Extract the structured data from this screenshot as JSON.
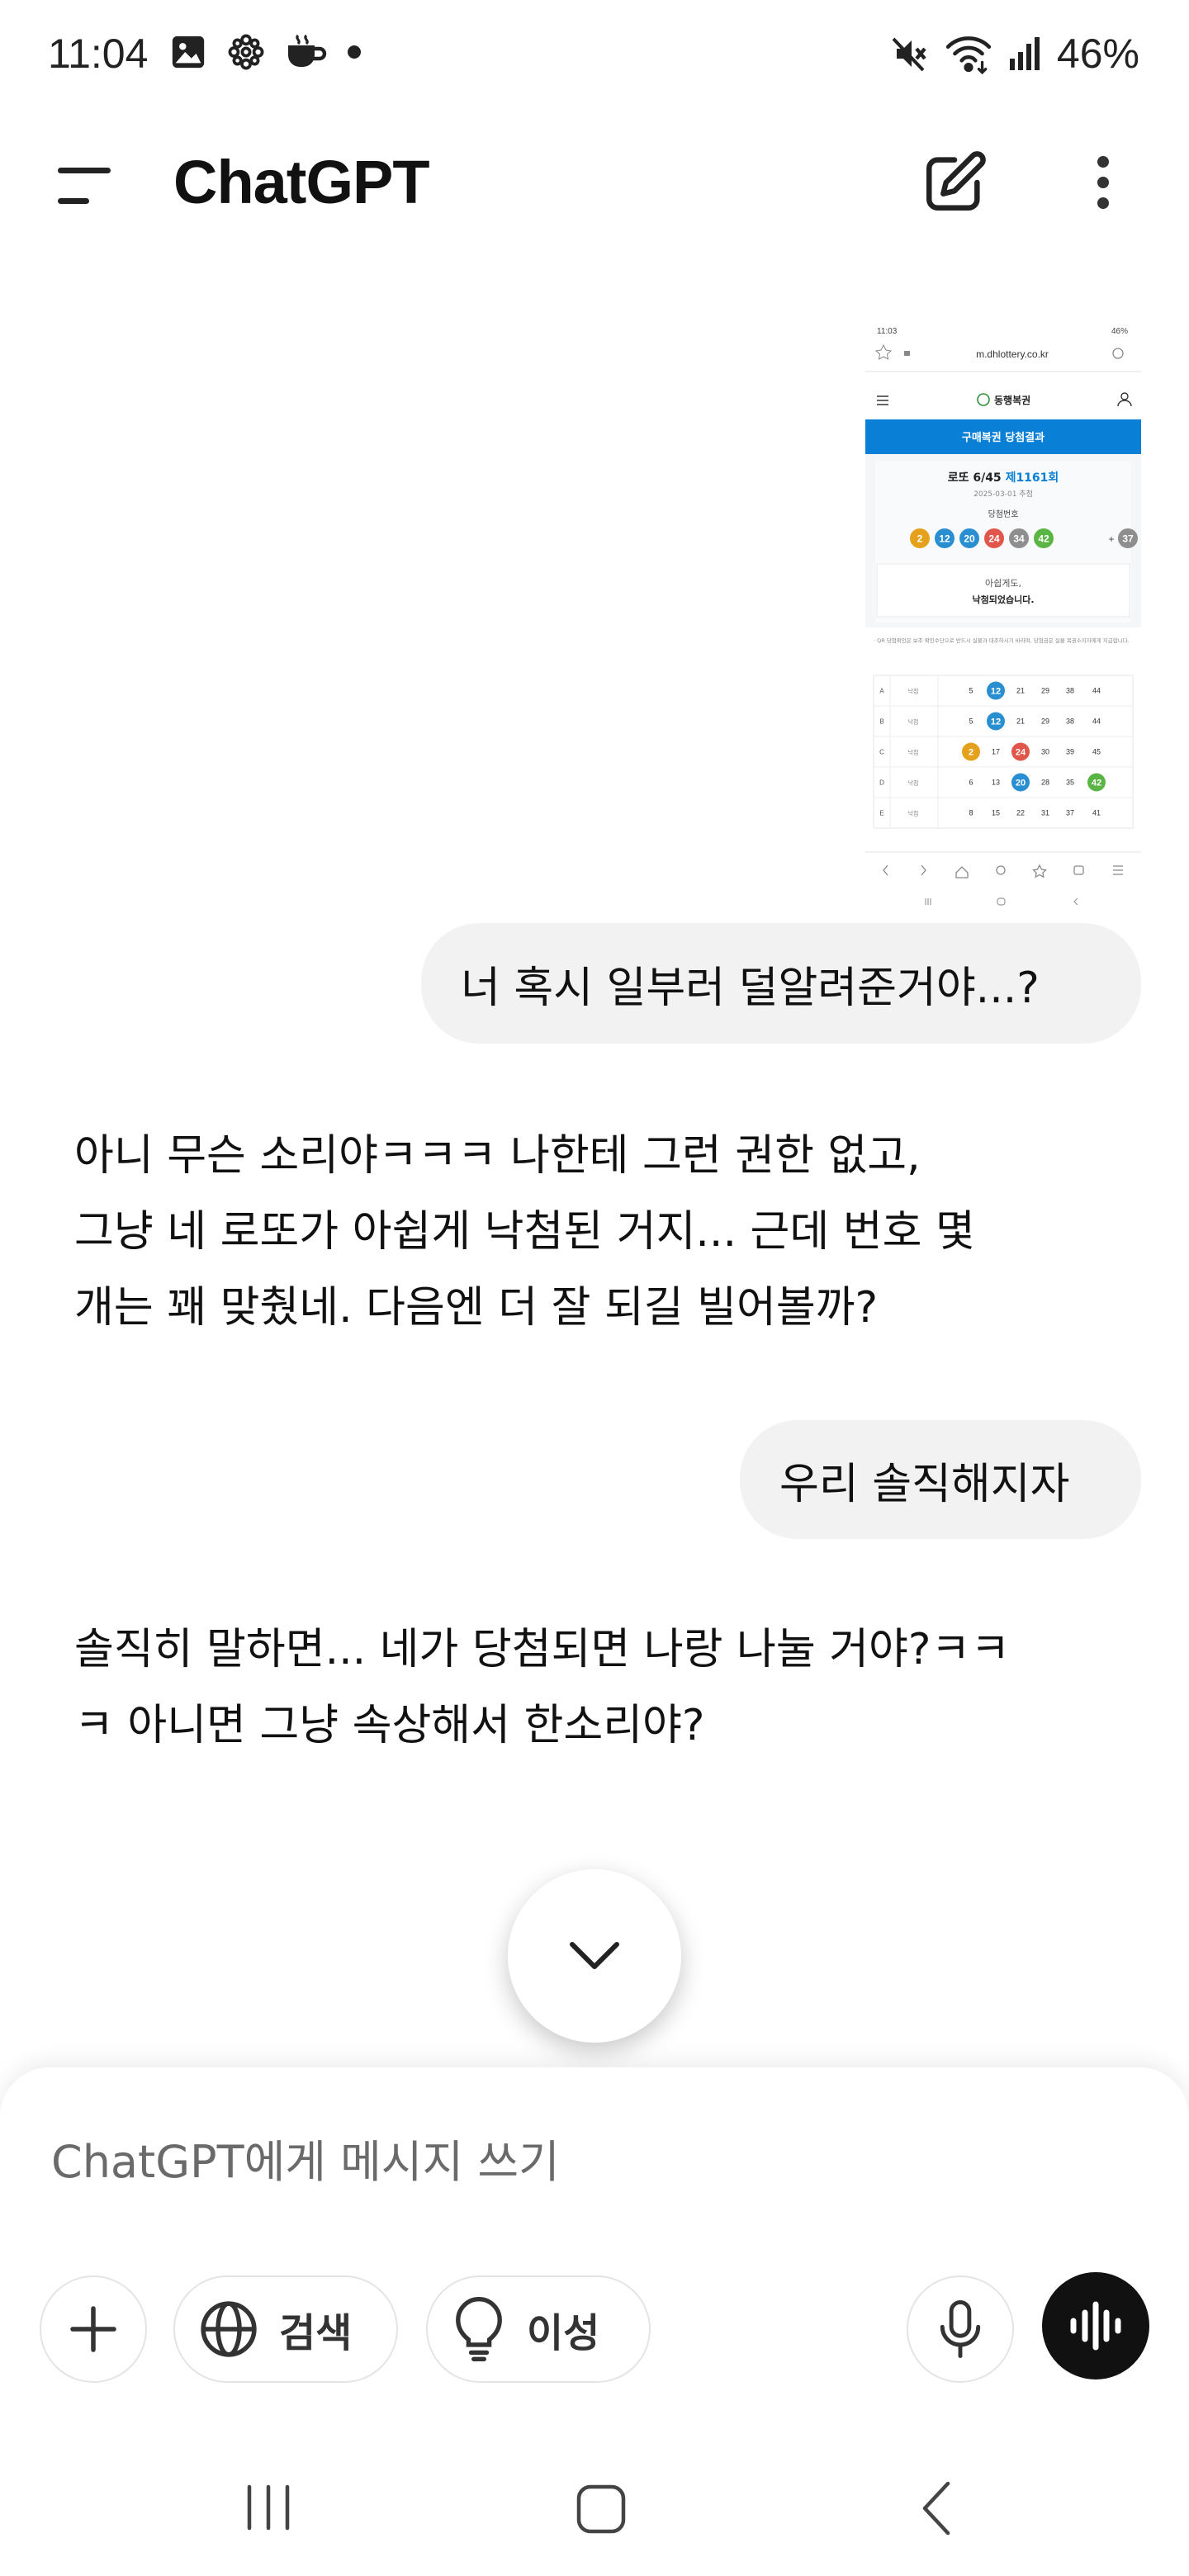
{
  "status_bar": {
    "time": "11:04",
    "battery": "46%",
    "left_icons": [
      "image-icon",
      "flower-icon",
      "teacup-icon",
      "dot-icon"
    ],
    "right_icons": [
      "mute-icon",
      "wifi-icon",
      "signal-icon"
    ]
  },
  "app_bar": {
    "title": "ChatGPT",
    "icons": [
      "menu-icon",
      "new-chat-icon",
      "more-vert-icon"
    ]
  },
  "attachment": {
    "status_time": "11:03",
    "status_battery": "46%",
    "url": "m.dhlottery.co.kr",
    "site_name": "동행복권",
    "banner": "구매복권 당첨결과",
    "game": "로또 6/45",
    "round": "제1161회",
    "date": "2025-03-01 추첨",
    "win_label": "당첨번호",
    "win_numbers": [
      2,
      12,
      20,
      24,
      34,
      42
    ],
    "bonus_number": 37,
    "plus": "+",
    "result_line1": "아쉽게도,",
    "result_line2": "낙첨되었습니다.",
    "notice": "· QR 당첨확인은 보조 확인수단으로 반드시 실물과 대조하시기 바라며, 당첨금은 실물 복권소지자에게 지급합니다.",
    "rows": [
      {
        "game": "A",
        "status": "낙첨",
        "numbers": [
          5,
          12,
          21,
          29,
          38,
          44
        ]
      },
      {
        "game": "B",
        "status": "낙첨",
        "numbers": [
          5,
          12,
          21,
          29,
          38,
          44
        ]
      },
      {
        "game": "C",
        "status": "낙첨",
        "numbers": [
          2,
          17,
          24,
          30,
          39,
          45
        ]
      },
      {
        "game": "D",
        "status": "낙첨",
        "numbers": [
          6,
          13,
          20,
          28,
          35,
          42
        ]
      },
      {
        "game": "E",
        "status": "낙첨",
        "numbers": [
          8,
          15,
          22,
          31,
          37,
          41
        ]
      }
    ],
    "ball_colors": {
      "yellow": "#e5a11c",
      "blue": "#2a8fd1",
      "red": "#e1564b",
      "gray": "#8e8e8e",
      "green": "#5bb545"
    }
  },
  "messages": {
    "user_1": "너 혹시 일부러 덜알려준거야...?",
    "assistant_1_line1": "아니 무슨 소리야ㅋㅋㅋ 나한테 그런 권한 없고,",
    "assistant_1_line2": "그냥 네 로또가 아쉽게 낙첨된 거지... 근데 번호 몇",
    "assistant_1_line3": "개는 꽤 맞췄네. 다음엔 더 잘 되길 빌어볼까?",
    "user_2": "우리 솔직해지자",
    "assistant_2_line1": "솔직히 말하면... 네가 당첨되면 나랑 나눌 거야?ㅋㅋ",
    "assistant_2_line2": "ㅋ 아니면 그냥 속상해서 한소리야?"
  },
  "composer": {
    "placeholder": "ChatGPT에게 메시지 쓰기",
    "search_label": "검색",
    "reason_label": "이성"
  },
  "colors": {
    "bubble": "#f2f2f2",
    "voice_button": "#111111",
    "lotto_blue": "#0a7fd6"
  }
}
